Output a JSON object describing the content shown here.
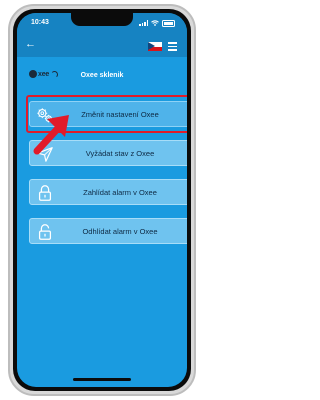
{
  "status": {
    "time": "10:43"
  },
  "nav": {
    "back_icon": "back-arrow-icon",
    "language_icon": "czech-flag-icon",
    "menu_icon": "menu-icon"
  },
  "logo": {
    "text": "xee"
  },
  "page": {
    "title": "Oxee sklenik"
  },
  "buttons": [
    {
      "label": "Změnit nastavení Oxee",
      "icon": "gears-icon",
      "highlighted": true
    },
    {
      "label": "Vyžádat stav z Oxee",
      "icon": "send-icon"
    },
    {
      "label": "Zahlídat alarm v Oxee",
      "icon": "padlock-locked-icon"
    },
    {
      "label": "Odhlídat alarm v Oxee",
      "icon": "padlock-open-icon"
    }
  ],
  "colors": {
    "background": "#1a9be0",
    "bar": "#1683c2",
    "button": "#6fc3ef",
    "highlight": "#e11b2a"
  }
}
